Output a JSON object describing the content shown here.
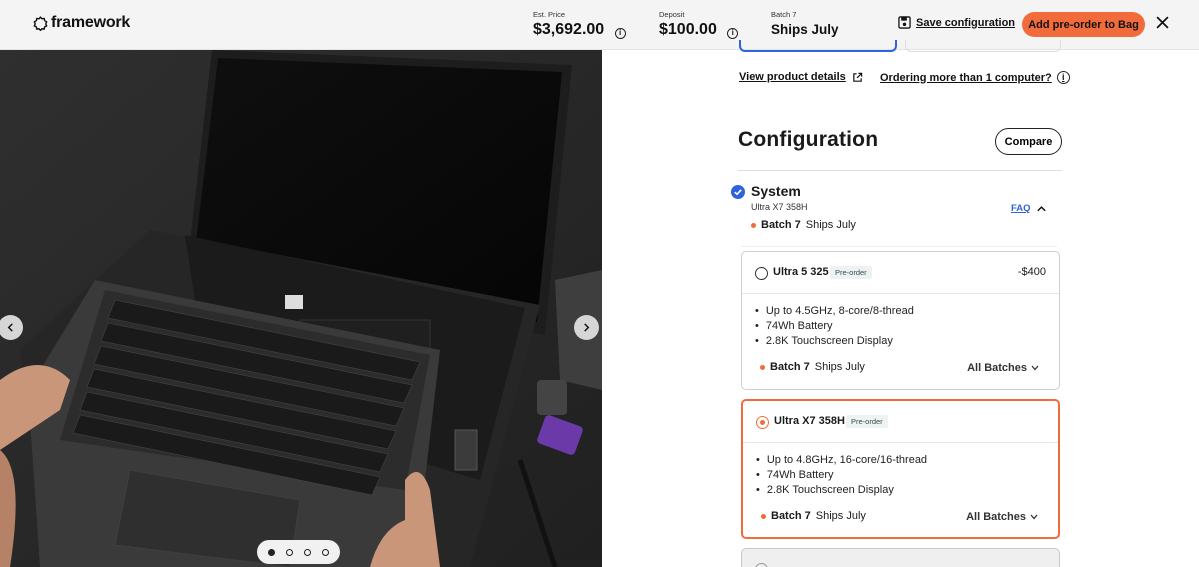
{
  "brand": {
    "name": "framework"
  },
  "header": {
    "est_price_label": "Est. Price",
    "est_price_value": "$3,692.00",
    "deposit_label": "Deposit",
    "deposit_value": "$100.00",
    "batch_label": "Batch 7",
    "batch_value": "Ships July",
    "save_label": "Save configuration",
    "add_label": "Add pre-order to Bag",
    "close_icon": "close-icon"
  },
  "links": {
    "view_details": "View product details",
    "ordering_more": "Ordering more than 1 computer?"
  },
  "configuration": {
    "title": "Configuration",
    "compare_label": "Compare"
  },
  "system": {
    "title": "System",
    "selected": "Ultra X7 358H",
    "faq": "FAQ",
    "batch": "Batch 7",
    "ships": "Ships July"
  },
  "options": [
    {
      "name": "Ultra 5 325",
      "badge": "Pre-order",
      "price": "-$400",
      "features": [
        "Up to 4.5GHz, 8-core/8-thread",
        "74Wh Battery",
        "2.8K Touchscreen Display"
      ],
      "batch": "Batch 7",
      "ships": "Ships July",
      "all_batches": "All Batches",
      "selected": false
    },
    {
      "name": "Ultra X7 358H",
      "badge": "Pre-order",
      "price": "",
      "features": [
        "Up to 4.8GHz, 16-core/16-thread",
        "74Wh Battery",
        "2.8K Touchscreen Display"
      ],
      "batch": "Batch 7",
      "ships": "Ships July",
      "all_batches": "All Batches",
      "selected": true
    }
  ],
  "carousel": {
    "slides": 4,
    "active_index": 0
  },
  "colors": {
    "accent_orange": "#f26c3b",
    "accent_blue": "#2e63d9"
  }
}
